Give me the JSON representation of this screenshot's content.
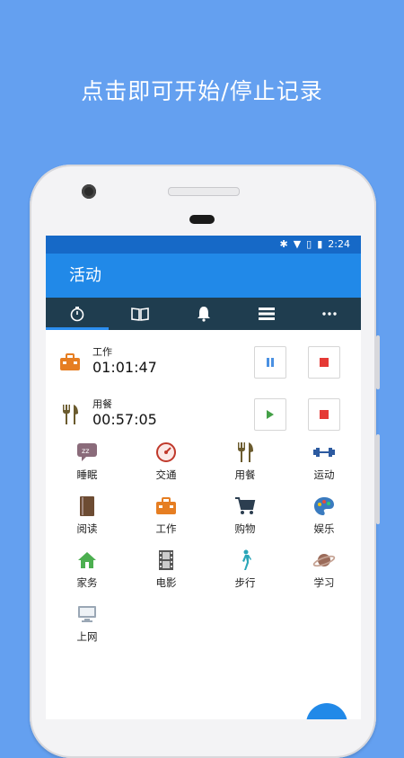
{
  "headline": "点击即可开始/停止记录",
  "status": {
    "time": "2:24"
  },
  "appbar": {
    "title": "活动"
  },
  "tabs": [
    {
      "icon": "stopwatch-icon",
      "active": true
    },
    {
      "icon": "book-icon",
      "active": false
    },
    {
      "icon": "bell-icon",
      "active": false
    },
    {
      "icon": "list-icon",
      "active": false
    },
    {
      "icon": "more-icon",
      "active": false
    }
  ],
  "running": [
    {
      "name": "工作",
      "time": "01:01:47",
      "icon": "briefcase-icon",
      "state": "running"
    },
    {
      "name": "用餐",
      "time": "00:57:05",
      "icon": "fork-knife-icon",
      "state": "paused"
    }
  ],
  "activities": [
    {
      "label": "睡眠",
      "icon": "sleep-icon",
      "color": "#8a6b7a"
    },
    {
      "label": "交通",
      "icon": "speedometer-icon",
      "color": "#c0392b"
    },
    {
      "label": "用餐",
      "icon": "fork-knife-icon",
      "color": "#6b5b2e"
    },
    {
      "label": "运动",
      "icon": "dumbbell-icon",
      "color": "#2c5aa0"
    },
    {
      "label": "阅读",
      "icon": "book-icon",
      "color": "#6d4c33"
    },
    {
      "label": "工作",
      "icon": "briefcase-icon",
      "color": "#e67e22"
    },
    {
      "label": "购物",
      "icon": "cart-icon",
      "color": "#2c3e50"
    },
    {
      "label": "娱乐",
      "icon": "palette-icon",
      "color": "#3a7bbf"
    },
    {
      "label": "家务",
      "icon": "home-icon",
      "color": "#4caf50"
    },
    {
      "label": "电影",
      "icon": "film-icon",
      "color": "#555555"
    },
    {
      "label": "步行",
      "icon": "walk-icon",
      "color": "#2aa6b8"
    },
    {
      "label": "学习",
      "icon": "planet-icon",
      "color": "#9b6b5a"
    },
    {
      "label": "上网",
      "icon": "monitor-icon",
      "color": "#9aa7b5"
    }
  ]
}
